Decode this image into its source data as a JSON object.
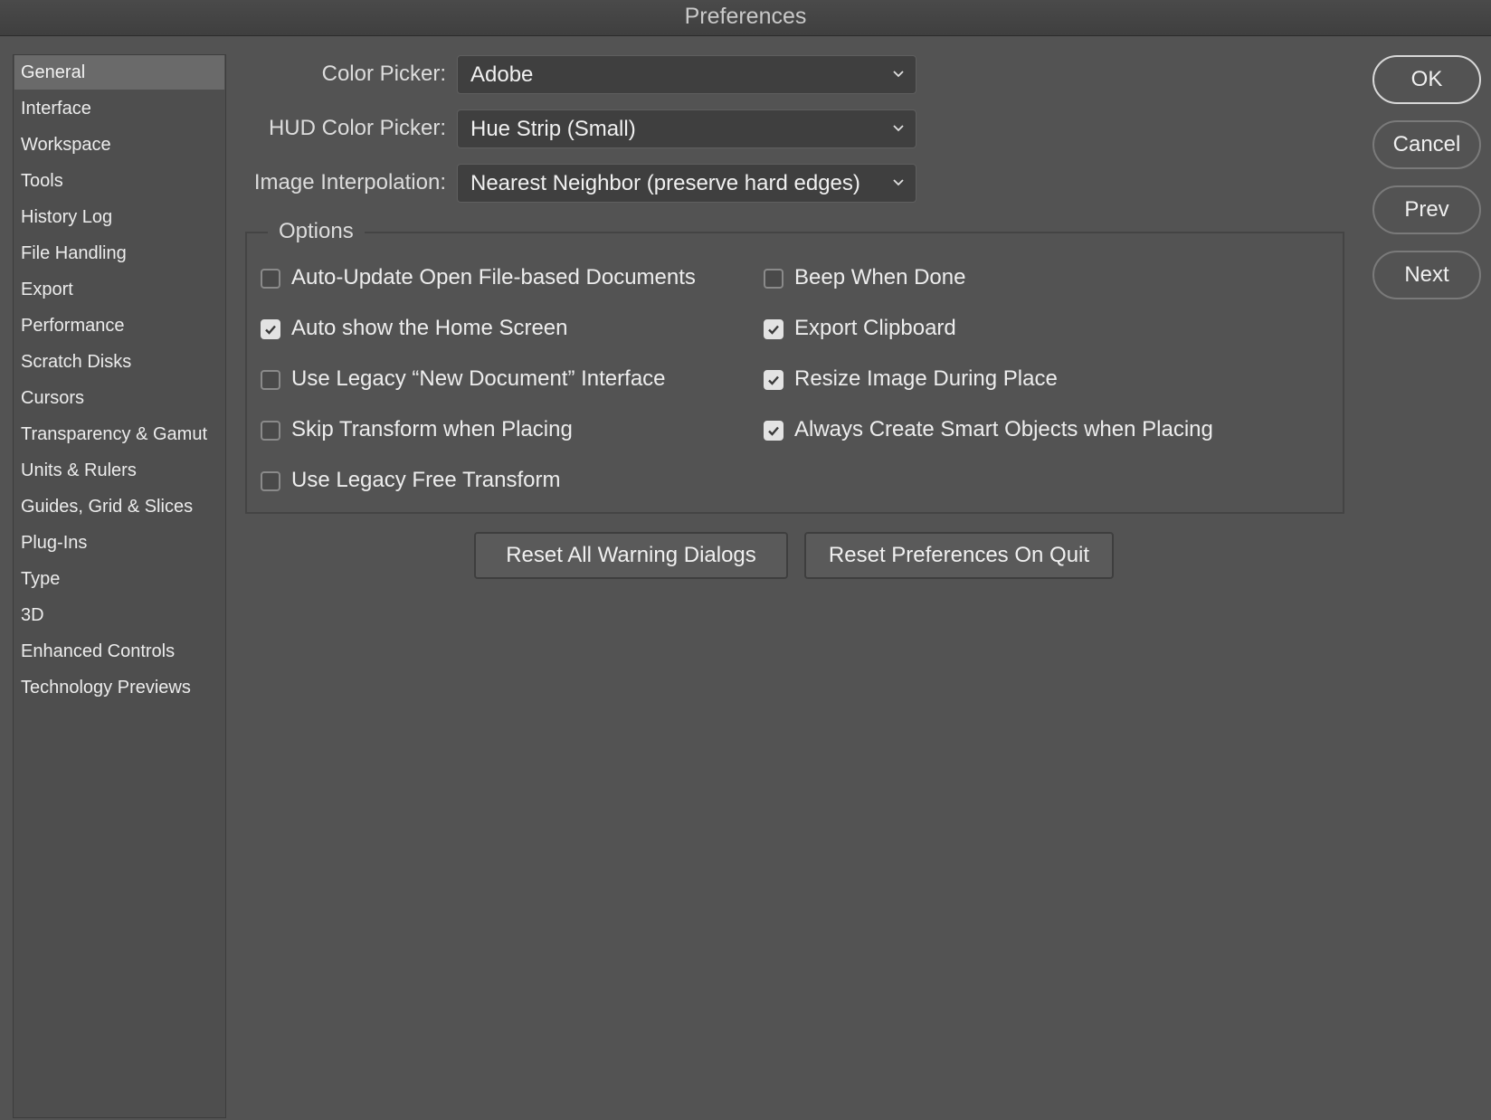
{
  "window": {
    "title": "Preferences"
  },
  "sidebar": {
    "selected": "General",
    "items": [
      "General",
      "Interface",
      "Workspace",
      "Tools",
      "History Log",
      "File Handling",
      "Export",
      "Performance",
      "Scratch Disks",
      "Cursors",
      "Transparency & Gamut",
      "Units & Rulers",
      "Guides, Grid & Slices",
      "Plug-Ins",
      "Type",
      "3D",
      "Enhanced Controls",
      "Technology Previews"
    ]
  },
  "fields": {
    "color_picker": {
      "label": "Color Picker:",
      "value": "Adobe"
    },
    "hud_color_picker": {
      "label": "HUD Color Picker:",
      "value": "Hue Strip (Small)"
    },
    "image_interpolation": {
      "label": "Image Interpolation:",
      "value": "Nearest Neighbor (preserve hard edges)"
    }
  },
  "options": {
    "legend": "Options",
    "left": [
      {
        "label": "Auto-Update Open File-based Documents",
        "checked": false
      },
      {
        "label": "Auto show the Home Screen",
        "checked": true
      },
      {
        "label": "Use Legacy “New Document” Interface",
        "checked": false
      },
      {
        "label": "Skip Transform when Placing",
        "checked": false
      },
      {
        "label": "Use Legacy Free Transform",
        "checked": false
      }
    ],
    "right": [
      {
        "label": "Beep When Done",
        "checked": false
      },
      {
        "label": "Export Clipboard",
        "checked": true
      },
      {
        "label": "Resize Image During Place",
        "checked": true
      },
      {
        "label": "Always Create Smart Objects when Placing",
        "checked": true
      }
    ]
  },
  "buttons": {
    "reset_warnings": "Reset All Warning Dialogs",
    "reset_prefs": "Reset Preferences On Quit",
    "ok": "OK",
    "cancel": "Cancel",
    "prev": "Prev",
    "next": "Next"
  },
  "icons": {
    "chevron": "chevron-down-icon",
    "check": "checkmark-icon"
  }
}
